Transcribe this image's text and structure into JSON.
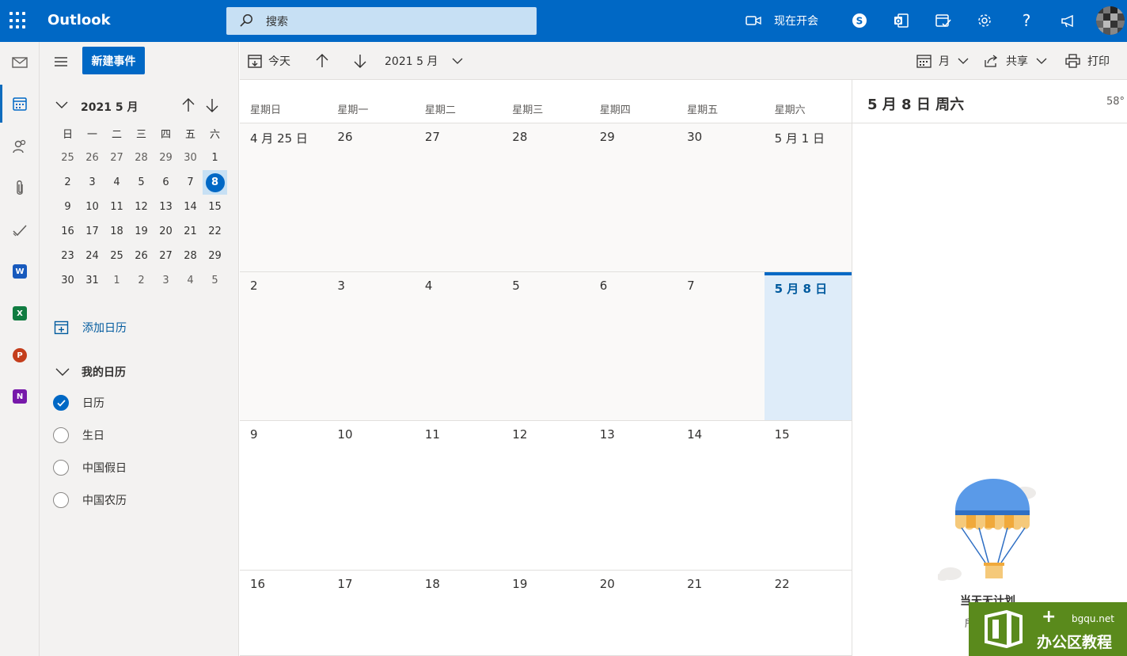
{
  "app": {
    "name": "Outlook"
  },
  "search": {
    "placeholder": "搜索"
  },
  "topbar": {
    "meet_now": "现在开会"
  },
  "left_panel": {
    "new_event": "新建事件",
    "mini_calendar": {
      "title": "2021 5 月",
      "weekdays": [
        "日",
        "一",
        "二",
        "三",
        "四",
        "五",
        "六"
      ],
      "weeks": [
        [
          "25",
          "26",
          "27",
          "28",
          "29",
          "30",
          "1"
        ],
        [
          "2",
          "3",
          "4",
          "5",
          "6",
          "7",
          "8"
        ],
        [
          "9",
          "10",
          "11",
          "12",
          "13",
          "14",
          "15"
        ],
        [
          "16",
          "17",
          "18",
          "19",
          "20",
          "21",
          "22"
        ],
        [
          "23",
          "24",
          "25",
          "26",
          "27",
          "28",
          "29"
        ],
        [
          "30",
          "31",
          "1",
          "2",
          "3",
          "4",
          "5"
        ]
      ],
      "selected": "8"
    },
    "add_calendar": "添加日历",
    "my_calendars": {
      "title": "我的日历",
      "items": [
        {
          "label": "日历",
          "checked": true
        },
        {
          "label": "生日",
          "checked": false
        },
        {
          "label": "中国假日",
          "checked": false
        },
        {
          "label": "中国农历",
          "checked": false
        }
      ]
    }
  },
  "commandbar": {
    "today": "今天",
    "period": "2021 5 月",
    "view": "月",
    "share": "共享",
    "print": "打印"
  },
  "month_view": {
    "weekdays": [
      "星期日",
      "星期一",
      "星期二",
      "星期三",
      "星期四",
      "星期五",
      "星期六"
    ],
    "weeks": [
      [
        "4 月 25 日",
        "26",
        "27",
        "28",
        "29",
        "30",
        "5 月 1 日"
      ],
      [
        "2",
        "3",
        "4",
        "5",
        "6",
        "7",
        "5 月 8 日"
      ],
      [
        "9",
        "10",
        "11",
        "12",
        "13",
        "14",
        "15"
      ],
      [
        "16",
        "17",
        "18",
        "19",
        "20",
        "21",
        "22"
      ]
    ],
    "today_label": "5 月 8 日"
  },
  "right_panel": {
    "title": "5 月 8 日 周六",
    "temperature": "58°",
    "empty_title": "当天无计划",
    "empty_sub": "所"
  },
  "watermark": {
    "url": "bgqu.net",
    "name": "办公区教程"
  },
  "colors": {
    "brand_blue": "#0068c5",
    "today_bg": "#deecf9",
    "watermark_green": "#5a8a1c"
  }
}
